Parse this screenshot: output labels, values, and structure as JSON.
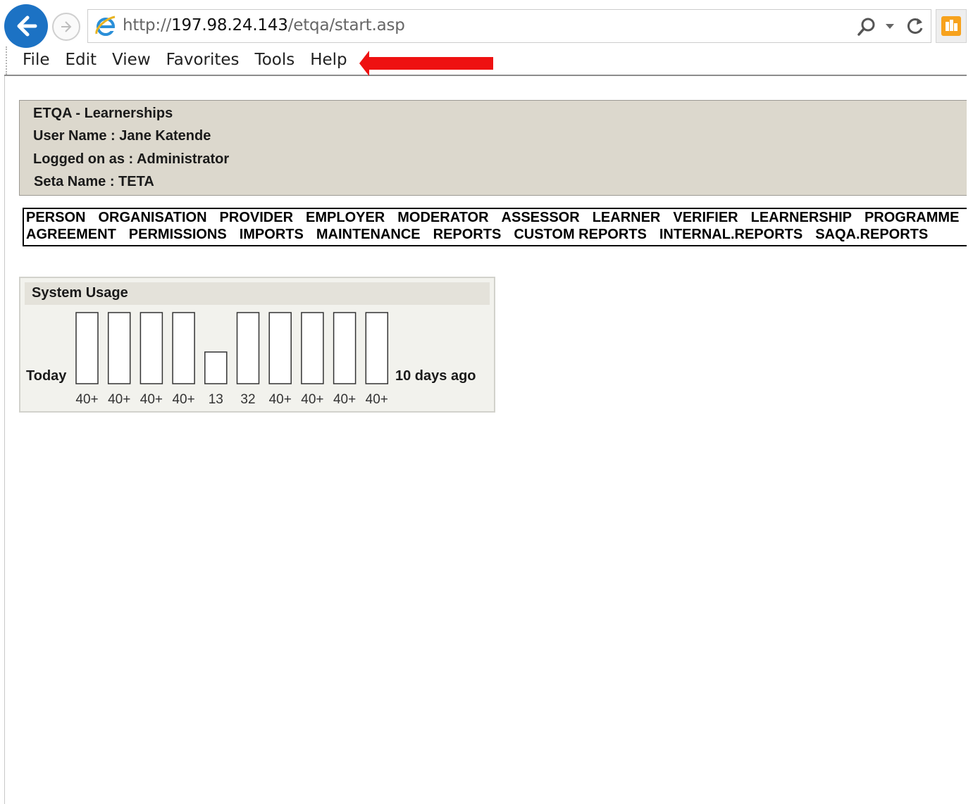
{
  "browser": {
    "url_prefix": "http://",
    "url_host": "197.98.24.143",
    "url_path": "/etqa/start.asp",
    "menu": [
      "File",
      "Edit",
      "View",
      "Favorites",
      "Tools",
      "Help"
    ],
    "annotation_arrow_color": "#ee1111"
  },
  "info": {
    "app_title": "ETQA - Learnerships",
    "user_name": "User Name : Jane Katende",
    "logged_on_as": "Logged on as : Administrator",
    "seta_name": "Seta Name : TETA"
  },
  "nav": {
    "row1": [
      "PERSON",
      "ORGANISATION",
      "PROVIDER",
      "EMPLOYER",
      "MODERATOR",
      "ASSESSOR",
      "LEARNER",
      "VERIFIER",
      "LEARNERSHIP",
      "PROGRAMME"
    ],
    "row2": [
      "AGREEMENT",
      "PERMISSIONS",
      "IMPORTS",
      "MAINTENANCE",
      "REPORTS",
      "CUSTOM REPORTS",
      "INTERNAL.REPORTS",
      "SAQA.REPORTS"
    ]
  },
  "usage": {
    "title": "System Usage",
    "left_label": "Today",
    "right_label": "10 days ago"
  },
  "chart_data": {
    "type": "bar",
    "categories": [
      "40+",
      "40+",
      "40+",
      "40+",
      "13",
      "32",
      "40+",
      "40+",
      "40+",
      "40+"
    ],
    "values": [
      40,
      40,
      40,
      40,
      18,
      40,
      40,
      40,
      40,
      40
    ],
    "ylim": [
      0,
      40
    ],
    "grid": false
  }
}
